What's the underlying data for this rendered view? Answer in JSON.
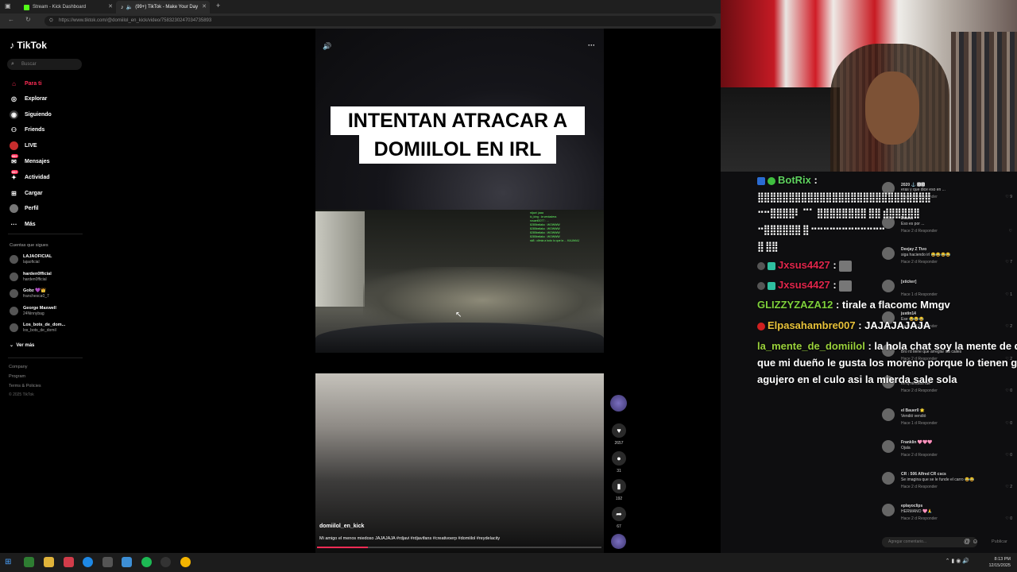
{
  "browser": {
    "tabs": [
      {
        "label": "Stream - Kick Dashboard"
      },
      {
        "label": "(99+) TikTok - Make Your Day"
      }
    ],
    "url": "https://www.tiktok.com/@domiilol_en_kick/video/7583230247034735893"
  },
  "tiktok": {
    "logo": "TikTok",
    "search_placeholder": "Buscar",
    "nav": [
      {
        "label": "Para ti",
        "icon": "home-icon",
        "active": true
      },
      {
        "label": "Explorar",
        "icon": "compass-icon"
      },
      {
        "label": "Siguiendo",
        "icon": "following-icon"
      },
      {
        "label": "Friends",
        "icon": "friends-icon"
      },
      {
        "label": "LIVE",
        "icon": "live-icon"
      },
      {
        "label": "Mensajes",
        "icon": "message-icon"
      },
      {
        "label": "Actividad",
        "icon": "bell-icon"
      },
      {
        "label": "Cargar",
        "icon": "upload-icon"
      },
      {
        "label": "Perfil",
        "icon": "profile-icon"
      },
      {
        "label": "Más",
        "icon": "more-icon"
      }
    ],
    "following_title": "Cuentas que sigues",
    "following": [
      {
        "name": "LAJAOFICIAL",
        "handle": "lajaoficial"
      },
      {
        "name": "harden0fficial",
        "handle": "harden0fficial"
      },
      {
        "name": "Gobz 💜👑",
        "handle": "franchesca0_7"
      },
      {
        "name": "George Maxwell",
        "handle": "24Ninnybag"
      },
      {
        "name": "Los_bots_de_dom...",
        "handle": "los_bots_de_domil"
      }
    ],
    "see_more": "Ver más",
    "footer": [
      "Company",
      "Program",
      "Terms & Policies",
      "© 2025 TikTok"
    ]
  },
  "video": {
    "caption_line1": "INTENTAN ATRACAR A",
    "caption_line2": "DOMIILOL EN IRL",
    "author": "domiilol_en_kick",
    "description": "Mi amigo el menos miedoso JAJAJAJA #rdjavi #rdjavifans #creativoerp #domiilol #reydelacity",
    "progress": 0.18,
    "overlay_chat": [
      "rdjavi: jaaa",
      "ki_king : la verdadera",
      "rosaelf2077 : ...",
      "8285beliako : WOWWW",
      "8285beliako : WOWWW",
      "8285beliako : WOWWW",
      "8285beliako : WOWWW",
      "sk8 : cllmia a todo lo que la ... KAJAKAJ"
    ],
    "actions": [
      {
        "icon": "heart-icon",
        "count": "2657"
      },
      {
        "icon": "comment-icon",
        "count": "31"
      },
      {
        "icon": "bookmark-icon",
        "count": "192"
      },
      {
        "icon": "share-icon",
        "count": "67"
      }
    ]
  },
  "kick_chat": [
    {
      "user": "BotRix",
      "text": "",
      "color": "#5fd35f"
    },
    {
      "user": "",
      "text": "⣿⣿⣿⣿⣿⣿⣿⣿⣿⣿⣿⣿⣿⣿⣿⣿⣿⣿⣿⣿⣿⣿⣿⣿⣿⣿⣿⣿",
      "color": "#ffffff"
    },
    {
      "user": "Jxsus4427",
      "text": "",
      "color": "#e0264b"
    },
    {
      "user": "Jxsus4427",
      "text": "",
      "color": "#e0264b"
    },
    {
      "user": "GLIZZYZAZA12",
      "text": "tirale a flacomc Mmgv",
      "color": "#7fd13b"
    },
    {
      "user": "Elpasahambre007",
      "text": "JAJAJAJAJA",
      "color": "#e8c23a"
    },
    {
      "user": "la_mente_de_domiilol",
      "text": "la hola chat soy la mente de d",
      "color": "#9ad13b"
    },
    {
      "user": "",
      "text": "que mi dueño le gusta los moreno porque lo tienen gr",
      "color": "#ffffff"
    },
    {
      "user": "",
      "text": "agujero en el culo asi la mierda sale sola",
      "color": "#ffffff"
    }
  ],
  "comments": [
    {
      "user": "2020 ⚓ 🅳🅳",
      "text": "eras y que dice eso en ...",
      "meta": "Hace 2 d   Responder",
      "likes": "9"
    },
    {
      "user": "Dasha",
      "text": "Eso es por ...",
      "meta": "Hace 2 d   Responder",
      "likes": ""
    },
    {
      "user": "Deejay Z Tivo",
      "text": "siga haciendo irl 😂😂😂😂",
      "meta": "Hace 2 d   Responder",
      "likes": "7"
    },
    {
      "user": "[sticker]",
      "text": "",
      "meta": "Hace 1 d   Responder",
      "likes": "1"
    },
    {
      "user": "justin14",
      "text": "Ese 😂😂😂",
      "meta": "Hace 2 d   Responder",
      "likes": "2"
    },
    {
      "user": "",
      "text": "Bro rd tiene que arreglar las calles",
      "meta": "Hace 2 d   Responder",
      "likes": "2"
    },
    {
      "user": "",
      "text": "en q minutos fue",
      "meta": "Hace 2 d   Responder",
      "likes": "0"
    },
    {
      "user": "el Bauer0 🌟",
      "text": "Vendió vendió",
      "meta": "Hace 1 d   Responder",
      "likes": "0"
    },
    {
      "user": "Franklin 🩷🩷🩷",
      "text": "Ojala",
      "meta": "Hace 2 d   Responder",
      "likes": "0"
    },
    {
      "user": "CR : 506 Alfred CR cscs",
      "text": "Se imagina que se le funde el carro 😂😂",
      "meta": "Hace 2 d   Responder",
      "likes": "2"
    },
    {
      "user": "eplayoclips",
      "text": "HERMANO 🩷🙏",
      "meta": "Hace 2 d   Responder",
      "likes": "0"
    }
  ],
  "comment_input_placeholder": "Agregar comentario...",
  "publish_label": "Publicar",
  "taskbar": {
    "time": "8:13 PM",
    "date": "12/15/2025"
  },
  "colors": {
    "accent": "#fe2c55"
  }
}
